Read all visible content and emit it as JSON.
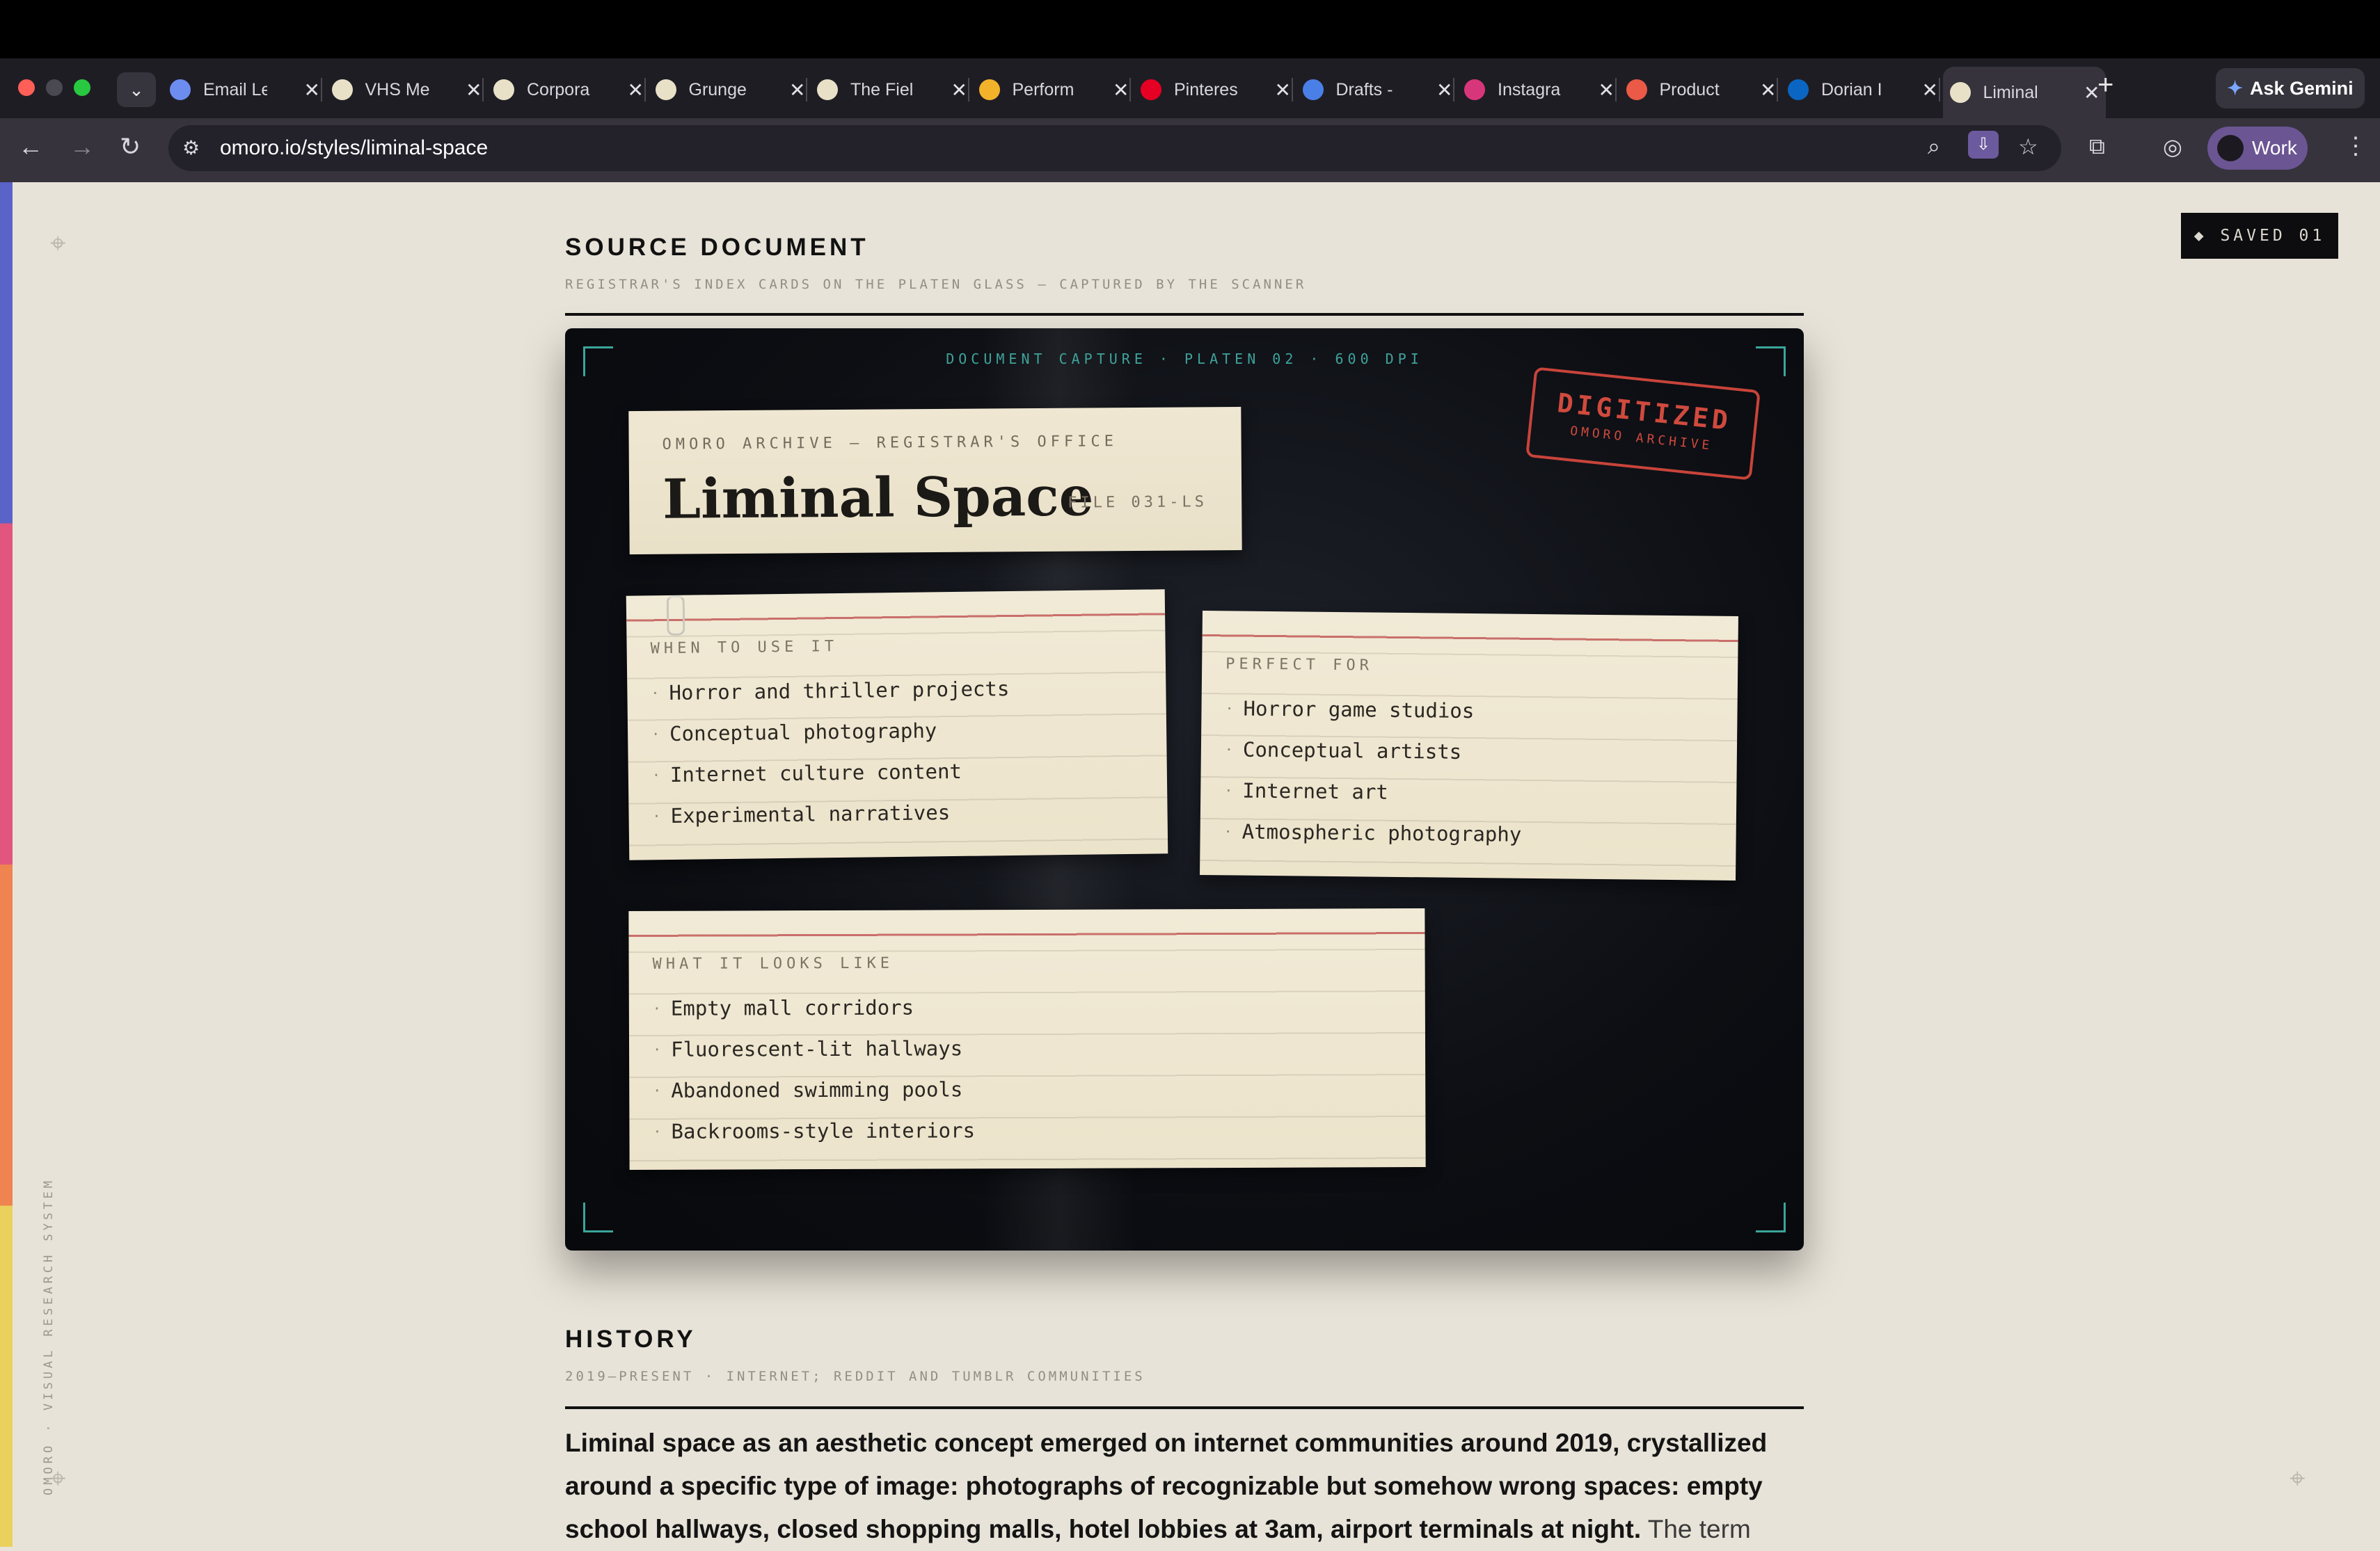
{
  "browser": {
    "tabs": [
      {
        "label": "Email Le",
        "favicon_color": "#6d8cf0"
      },
      {
        "label": "VHS Me",
        "favicon_color": "#e8e1c8"
      },
      {
        "label": "Corpora",
        "favicon_color": "#e8e1c8"
      },
      {
        "label": "Grunge",
        "favicon_color": "#e8e1c8"
      },
      {
        "label": "The Fiel",
        "favicon_color": "#e8e1c8"
      },
      {
        "label": "Perform",
        "favicon_color": "#f2b32a"
      },
      {
        "label": "Pinteres",
        "favicon_color": "#e60023"
      },
      {
        "label": "Drafts -",
        "favicon_color": "#4a7fe8"
      },
      {
        "label": "Instagra",
        "favicon_color": "#d8367a"
      },
      {
        "label": "Product",
        "favicon_color": "#ea5a47"
      },
      {
        "label": "Dorian I",
        "favicon_color": "#0a66c2"
      },
      {
        "label": "Liminal",
        "favicon_color": "#e8e1c8"
      }
    ],
    "active_tab_index": 11,
    "new_tab_glyph": "+",
    "ask_gemini_label": "Ask Gemini",
    "url": "omoro.io/styles/liminal-space",
    "profile_label": "Work"
  },
  "page": {
    "saved_badge": "◆  SAVED  01",
    "side_caption": "OMORO · VISUAL RESEARCH SYSTEM",
    "source_section": {
      "title": "SOURCE DOCUMENT",
      "subtitle": "REGISTRAR'S INDEX CARDS ON THE PLATEN GLASS — CAPTURED BY THE SCANNER"
    },
    "scanner": {
      "capture_label": "DOCUMENT CAPTURE · PLATEN 02 · 600 DPI",
      "stamp_main": "DIGITIZED",
      "stamp_sub": "OMORO ARCHIVE",
      "title_card": {
        "kicker": "OMORO ARCHIVE — REGISTRAR'S OFFICE",
        "title": "Liminal Space",
        "file": "FILE 031-LS"
      },
      "when_card": {
        "heading": "WHEN TO USE IT",
        "items": [
          "Horror and thriller projects",
          "Conceptual photography",
          "Internet culture content",
          "Experimental narratives"
        ]
      },
      "perfect_card": {
        "heading": "PERFECT FOR",
        "items": [
          "Horror game studios",
          "Conceptual artists",
          "Internet art",
          "Atmospheric photography"
        ]
      },
      "looks_card": {
        "heading": "WHAT IT LOOKS LIKE",
        "items": [
          "Empty mall corridors",
          "Fluorescent-lit hallways",
          "Abandoned swimming pools",
          "Backrooms-style interiors"
        ]
      }
    },
    "history_section": {
      "title": "HISTORY",
      "subtitle": "2019—PRESENT · INTERNET; REDDIT AND TUMBLR COMMUNITIES",
      "lead": "Liminal space as an aesthetic concept emerged on internet communities around 2019, crystallized around a specific type of image: photographs of recognizable but somehow wrong spaces: empty school hallways, closed shopping malls, hotel lobbies at 3am, airport terminals at night.",
      "tail": "The term"
    }
  }
}
